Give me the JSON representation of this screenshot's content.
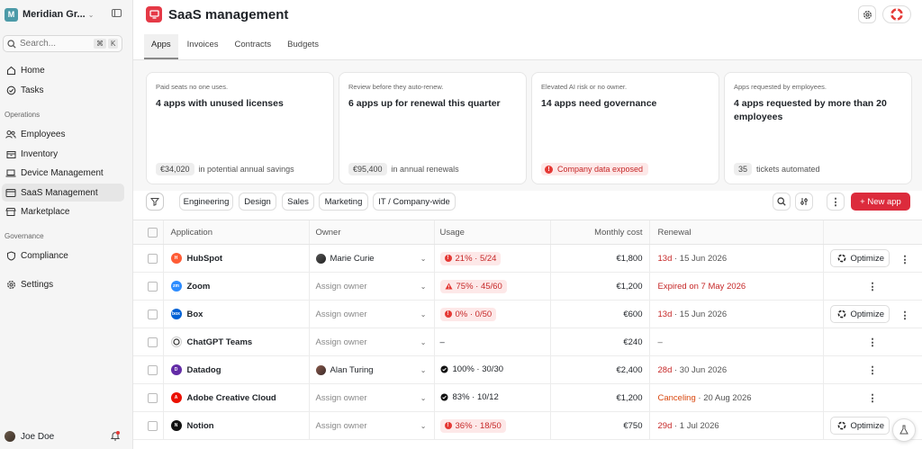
{
  "workspace": {
    "name": "Meridian Gr...",
    "initial": "M"
  },
  "search": {
    "placeholder": "Search...",
    "kbd_mod": "⌘",
    "kbd_key": "K"
  },
  "nav": {
    "home": "Home",
    "tasks": "Tasks",
    "section_operations": "Operations",
    "employees": "Employees",
    "inventory": "Inventory",
    "device_management": "Device Management",
    "saas_management": "SaaS Management",
    "marketplace": "Marketplace",
    "section_governance": "Governance",
    "compliance": "Compliance",
    "settings": "Settings"
  },
  "user": {
    "name": "Joe Doe"
  },
  "page": {
    "title": "SaaS management"
  },
  "tabs": [
    "Apps",
    "Invoices",
    "Contracts",
    "Budgets"
  ],
  "cards": [
    {
      "sub": "Paid seats no one uses.",
      "head": "4 apps with unused licenses",
      "pill": "€34,020",
      "foot": "in potential annual savings"
    },
    {
      "sub": "Review before they auto-renew.",
      "head": "6 apps up for renewal this quarter",
      "pill": "€95,400",
      "foot": "in annual renewals"
    },
    {
      "sub": "Elevated AI risk or no owner.",
      "head": "14 apps need governance",
      "alert": "Company data exposed"
    },
    {
      "sub": "Apps requested by employees.",
      "head": "4 apps requested by more than 20 employees",
      "pill": "35",
      "foot": "tickets automated"
    }
  ],
  "filters": [
    "Engineering",
    "Design",
    "Sales",
    "Marketing",
    "IT / Company-wide"
  ],
  "new_app_label": "+ New app",
  "table": {
    "headers": {
      "application": "Application",
      "owner": "Owner",
      "usage": "Usage",
      "cost": "Monthly cost",
      "renewal": "Renewal"
    },
    "rows": [
      {
        "app": "HubSpot",
        "logo_color": "#ff5c35",
        "logo_text": "H",
        "owner": "Marie Curie",
        "owner_assigned": true,
        "usage": "21% · 5/24",
        "usage_status": "low",
        "cost": "€1,800",
        "renew_main": "13d",
        "renew_sub": "· 15 Jun 2026",
        "renew_tone": "red",
        "action": "Optimize"
      },
      {
        "app": "Zoom",
        "logo_color": "#2d8cff",
        "logo_text": "zm",
        "owner": "Assign owner",
        "owner_assigned": false,
        "usage": "75% · 45/60",
        "usage_status": "warn",
        "cost": "€1,200",
        "renew_main": "Expired on 7 May 2026",
        "renew_sub": "",
        "renew_tone": "red",
        "action": ""
      },
      {
        "app": "Box",
        "logo_color": "#0061d5",
        "logo_text": "box",
        "owner": "Assign owner",
        "owner_assigned": false,
        "usage": "0% · 0/50",
        "usage_status": "low",
        "cost": "€600",
        "renew_main": "13d",
        "renew_sub": "· 15 Jun 2026",
        "renew_tone": "red",
        "action": "Optimize"
      },
      {
        "app": "ChatGPT Teams",
        "logo_color": "#ffffff",
        "logo_text": "",
        "owner": "Assign owner",
        "owner_assigned": false,
        "usage": "–",
        "usage_status": "none",
        "cost": "€240",
        "renew_main": "–",
        "renew_sub": "",
        "renew_tone": "date",
        "action": ""
      },
      {
        "app": "Datadog",
        "logo_color": "#632ca6",
        "logo_text": "D",
        "owner": "Alan Turing",
        "owner_assigned": true,
        "usage": "100% · 30/30",
        "usage_status": "ok",
        "cost": "€2,400",
        "renew_main": "28d",
        "renew_sub": "· 30 Jun 2026",
        "renew_tone": "red",
        "action": ""
      },
      {
        "app": "Adobe Creative Cloud",
        "logo_color": "#eb1000",
        "logo_text": "A",
        "owner": "Assign owner",
        "owner_assigned": false,
        "usage": "83% · 10/12",
        "usage_status": "ok",
        "cost": "€1,200",
        "renew_main": "Canceling",
        "renew_sub": "· 20 Aug 2026",
        "renew_tone": "orange",
        "action": ""
      },
      {
        "app": "Notion",
        "logo_color": "#111111",
        "logo_text": "N",
        "owner": "Assign owner",
        "owner_assigned": false,
        "usage": "36% · 18/50",
        "usage_status": "low",
        "cost": "€750",
        "renew_main": "29d",
        "renew_sub": "· 1 Jul 2026",
        "renew_tone": "red",
        "action": "Optimize"
      }
    ]
  }
}
